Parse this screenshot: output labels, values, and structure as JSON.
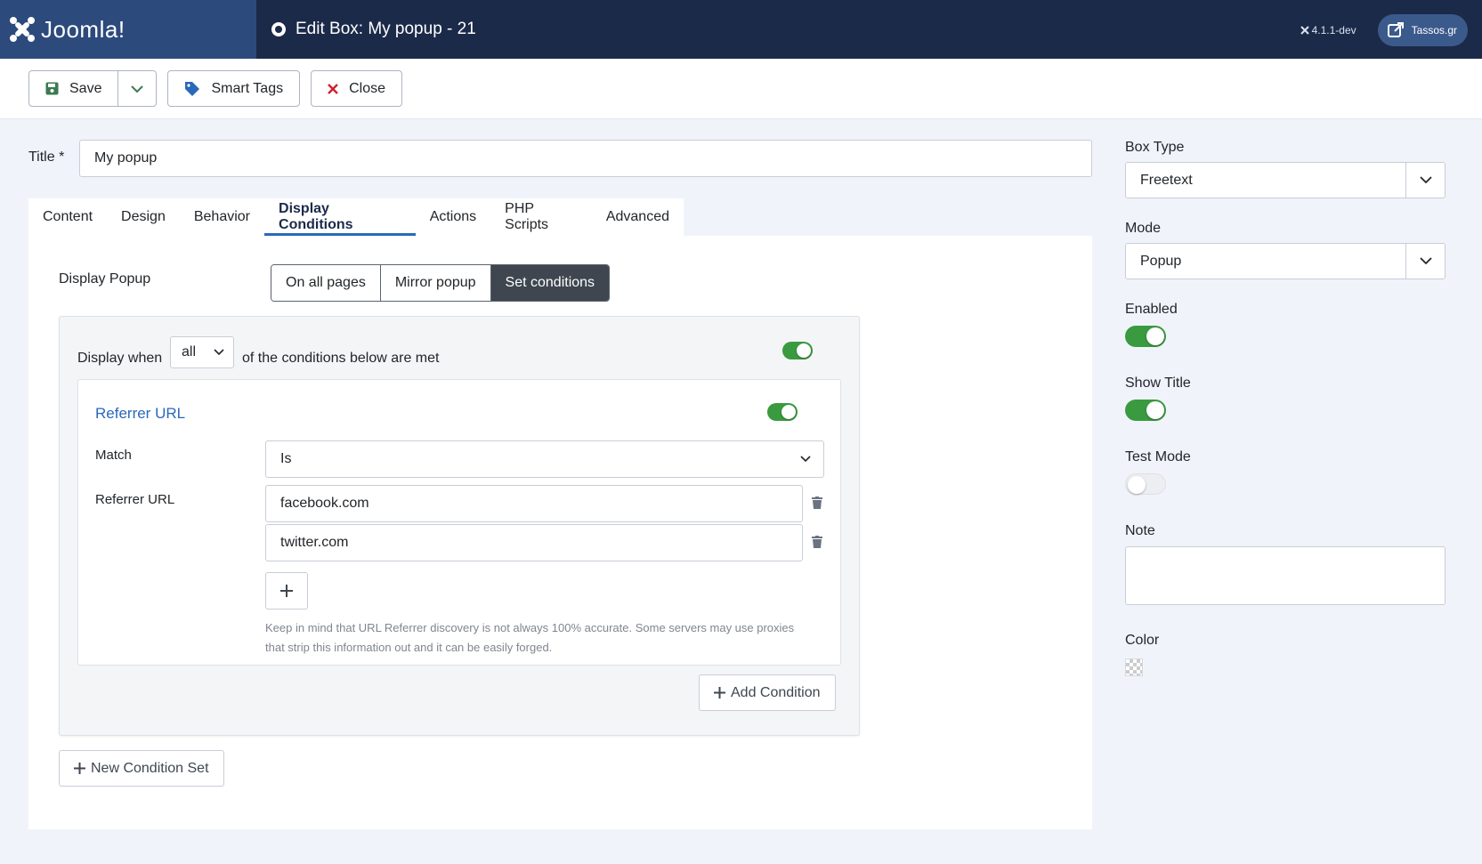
{
  "header": {
    "logo_text": "Joomla!",
    "page_title": "Edit Box: My popup - 21",
    "version": "4.1.1-dev",
    "site_link": "Tassos.gr"
  },
  "toolbar": {
    "save_label": "Save",
    "smart_tags_label": "Smart Tags",
    "close_label": "Close"
  },
  "form": {
    "title_label": "Title *",
    "title_value": "My popup"
  },
  "tabs": [
    {
      "label": "Content"
    },
    {
      "label": "Design"
    },
    {
      "label": "Behavior"
    },
    {
      "label": "Display Conditions",
      "active": true
    },
    {
      "label": "Actions"
    },
    {
      "label": "PHP Scripts"
    },
    {
      "label": "Advanced"
    }
  ],
  "display_conditions": {
    "display_popup_label": "Display Popup",
    "options": [
      "On all pages",
      "Mirror popup",
      "Set conditions"
    ],
    "selected_option": "Set conditions",
    "display_when_label": "Display when",
    "match_all_value": "all",
    "display_when_suffix": "of the conditions below are met",
    "set_enabled": true,
    "condition": {
      "title": "Referrer URL",
      "enabled": true,
      "match_label": "Match",
      "match_value": "Is",
      "urls_label": "Referrer URL",
      "urls": [
        "facebook.com",
        "twitter.com"
      ],
      "hint": "Keep in mind that URL Referrer discovery is not always 100% accurate. Some servers may use proxies that strip this information out and it can be easily forged."
    },
    "add_condition_label": "Add Condition",
    "new_condition_set_label": "New Condition Set"
  },
  "sidebar": {
    "box_type_label": "Box Type",
    "box_type_value": "Freetext",
    "mode_label": "Mode",
    "mode_value": "Popup",
    "enabled_label": "Enabled",
    "enabled": true,
    "show_title_label": "Show Title",
    "show_title": true,
    "test_mode_label": "Test Mode",
    "test_mode": false,
    "note_label": "Note",
    "note_value": "",
    "color_label": "Color"
  },
  "colors": {
    "header_bg": "#1c2a49",
    "accent": "#2a69b8",
    "toggle_on": "#3a9a3f",
    "active_segment": "#3f4650",
    "close_icon": "#d0202e",
    "save_icon": "#3a7a50"
  }
}
